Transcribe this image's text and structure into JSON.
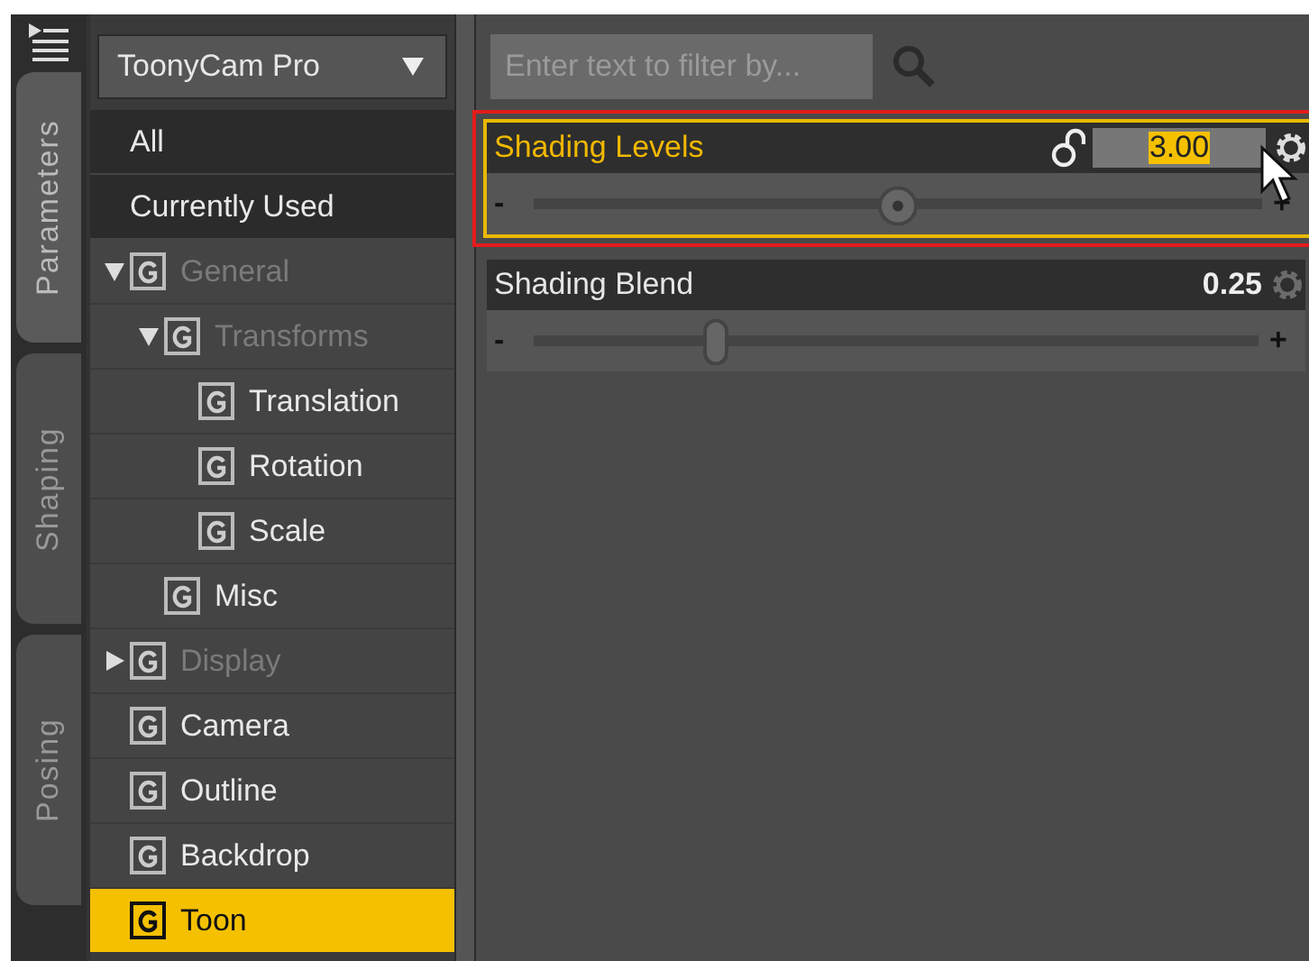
{
  "side_tabs": [
    {
      "label": "Parameters",
      "selected": true
    },
    {
      "label": "Shaping",
      "selected": false
    },
    {
      "label": "Posing",
      "selected": false
    }
  ],
  "preset_dropdown": {
    "value": "ToonyCam Pro"
  },
  "filters": [
    {
      "label": "All",
      "selected": false
    },
    {
      "label": "Currently Used",
      "selected": false
    }
  ],
  "tree": [
    {
      "label": "General",
      "dimmed": true,
      "expanded": true,
      "selected": false,
      "children": [
        {
          "label": "Transforms",
          "dimmed": true,
          "expanded": true,
          "selected": false,
          "children": [
            {
              "label": "Translation",
              "dimmed": false,
              "selected": false
            },
            {
              "label": "Rotation",
              "dimmed": false,
              "selected": false
            },
            {
              "label": "Scale",
              "dimmed": false,
              "selected": false
            }
          ]
        },
        {
          "label": "Misc",
          "dimmed": false,
          "selected": false
        }
      ]
    },
    {
      "label": "Display",
      "dimmed": true,
      "expanded": false,
      "selected": false
    },
    {
      "label": "Camera",
      "dimmed": false,
      "selected": false
    },
    {
      "label": "Outline",
      "dimmed": false,
      "selected": false
    },
    {
      "label": "Backdrop",
      "dimmed": false,
      "selected": false
    },
    {
      "label": "Toon",
      "dimmed": false,
      "selected": true
    }
  ],
  "search": {
    "placeholder": "Enter text to filter by..."
  },
  "parameters": [
    {
      "name": "Shading Levels",
      "value": "3.00",
      "level": 0.5,
      "selected": true,
      "outlined": true,
      "minus": "-",
      "plus": "+"
    },
    {
      "name": "Shading Blend",
      "value": "0.25",
      "level": 0.25,
      "selected": false,
      "minus": "-",
      "plus": "+"
    }
  ]
}
